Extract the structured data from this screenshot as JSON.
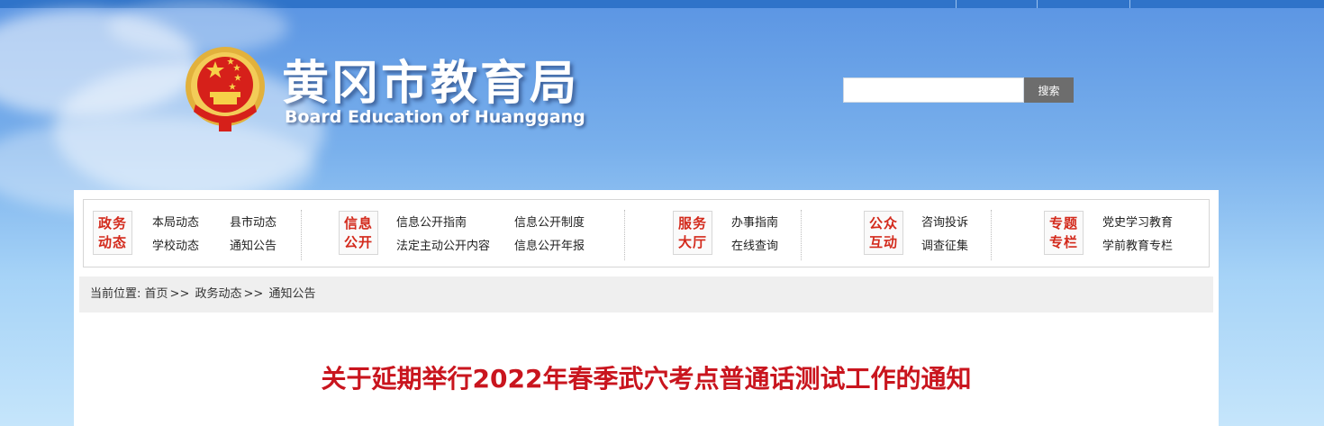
{
  "header": {
    "title": "黄冈市教育局",
    "subtitle": "Board Education of Huanggang",
    "emblem_icon": "national-emblem-icon"
  },
  "search": {
    "placeholder": "",
    "value": "",
    "button_label": "搜索"
  },
  "nav": {
    "groups": [
      {
        "badge_line1": "政务",
        "badge_line2": "动态",
        "links": [
          "本局动态",
          "县市动态",
          "学校动态",
          "通知公告"
        ]
      },
      {
        "badge_line1": "信息",
        "badge_line2": "公开",
        "links": [
          "信息公开指南",
          "信息公开制度",
          "法定主动公开内容",
          "信息公开年报"
        ]
      },
      {
        "badge_line1": "服务",
        "badge_line2": "大厅",
        "links": [
          "办事指南",
          "在线查询"
        ]
      },
      {
        "badge_line1": "公众",
        "badge_line2": "互动",
        "links": [
          "咨询投诉",
          "调查征集"
        ]
      },
      {
        "badge_line1": "专题",
        "badge_line2": "专栏",
        "links": [
          "党史学习教育",
          "学前教育专栏"
        ]
      }
    ]
  },
  "breadcrumb": {
    "prefix": "当前位置:",
    "items": [
      "首页",
      "政务动态",
      "通知公告"
    ],
    "separator": ">>"
  },
  "article": {
    "title": "关于延期举行2022年春季武穴考点普通话测试工作的通知"
  },
  "colors": {
    "accent_red": "#c9151e",
    "topbar_blue": "#2f73c9",
    "search_button": "#6d6d6d"
  }
}
